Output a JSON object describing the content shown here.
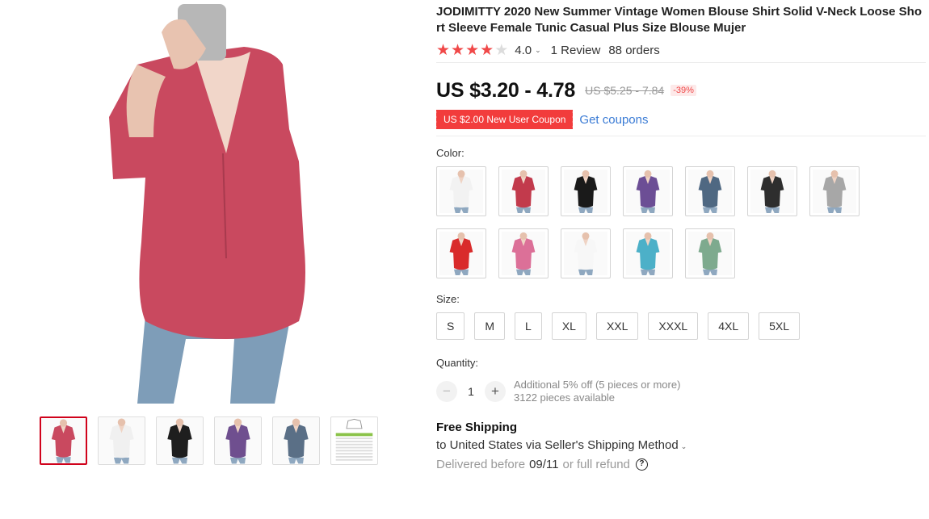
{
  "product": {
    "title": "JODIMITTY 2020 New Summer Vintage Women Blouse Shirt Solid V-Neck Loose Short Sleeve Female Tunic Casual Plus Size Blouse Mujer",
    "rating": {
      "stars_filled": 4,
      "stars_total": 5,
      "value": "4.0",
      "reviews": "1 Review",
      "orders": "88 orders"
    },
    "price": "US $3.20 - 4.78",
    "original_price": "US $5.25 - 7.84",
    "discount": "-39%",
    "coupon": "US $2.00 New User Coupon",
    "get_coupons": "Get coupons"
  },
  "gallery": {
    "main_color": "#c9495f",
    "thumbnails": [
      {
        "color": "#c9495f",
        "active": true
      },
      {
        "color": "#f0f0f0",
        "active": false
      },
      {
        "color": "#1e1e1e",
        "active": false
      },
      {
        "color": "#6f4f8f",
        "active": false
      },
      {
        "color": "#5a6f86",
        "active": false
      },
      {
        "color": "#e6e6e6",
        "active": false
      }
    ]
  },
  "color_section": {
    "label": "Color:",
    "options": [
      {
        "color": "#f2f2f2"
      },
      {
        "color": "#c23a4c"
      },
      {
        "color": "#1a1a1a"
      },
      {
        "color": "#6c4e95"
      },
      {
        "color": "#4f6882"
      },
      {
        "color": "#2e2e2e"
      },
      {
        "color": "#a7a7a7"
      },
      {
        "color": "#d92b2b"
      },
      {
        "color": "#dc7098"
      },
      {
        "color": "#f7f7f7"
      },
      {
        "color": "#4cb0c8"
      },
      {
        "color": "#7eaa8e"
      }
    ]
  },
  "size_section": {
    "label": "Size:",
    "options": [
      "S",
      "M",
      "L",
      "XL",
      "XXL",
      "XXXL",
      "4XL",
      "5XL"
    ]
  },
  "quantity_section": {
    "label": "Quantity:",
    "value": "1",
    "minus": "−",
    "plus": "+",
    "additional": "Additional 5% off (5 pieces or more)",
    "available": "3122 pieces available"
  },
  "shipping": {
    "title": "Free Shipping",
    "destination": "to United States via Seller's Shipping Method",
    "delivery_prefix": "Delivered before",
    "delivery_date": "09/11",
    "delivery_suffix": "or full refund"
  }
}
